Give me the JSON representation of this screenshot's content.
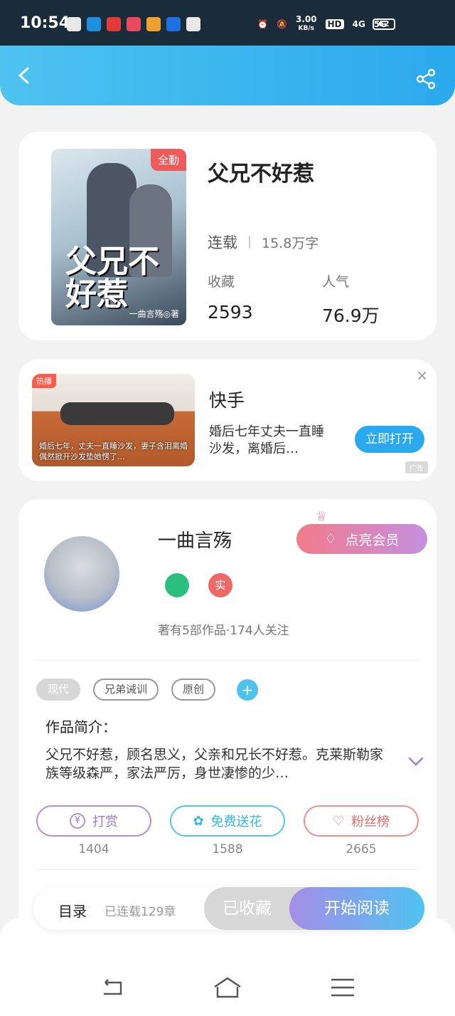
{
  "status_bar": {
    "time": "10:54",
    "net_speed": "3.00",
    "net_unit": "KB/s",
    "hd": "HD",
    "g4": "4G",
    "g5": "5G",
    "battery": "62"
  },
  "header": {
    "back_icon": "back-arrow-icon",
    "share_icon": "share-icon"
  },
  "book": {
    "badge": "全勤",
    "cover_title": "父兄不好惹",
    "cover_author": "一曲言殇◎著",
    "title": "父兄不好惹",
    "status": "连载",
    "words": "15.8万字",
    "collect_label": "收藏",
    "collect_value": "2593",
    "popularity_label": "人气",
    "popularity_value": "76.9万"
  },
  "ad": {
    "hot_label": "热播",
    "caption": "婚后七年，丈夫一直睡沙发，妻子含泪离婚 偶然掀开沙发垫她愣了...",
    "title": "快手",
    "desc": "婚后七年丈夫一直睡沙发，离婚后…",
    "button": "立即打开",
    "close": "×",
    "ad_tag": "广告"
  },
  "author": {
    "name": "一曲言殇",
    "vip_button": "点亮会员",
    "real_badge": "实",
    "info": "著有5部作品·174人关注",
    "tags": [
      "现代",
      "兄弟诫训",
      "原创"
    ],
    "add_tag": "+",
    "intro_label": "作品简介：",
    "intro_text": "父兄不好惹，顾名思义，父亲和兄长不好惹。克莱斯勒家族等级森严，家法严厉，身世凄惨的少…"
  },
  "actions": {
    "reward_label": "打赏",
    "reward_count": "1404",
    "flower_label": "免费送花",
    "flower_count": "1588",
    "fans_label": "粉丝榜",
    "fans_count": "2665"
  },
  "bottom_bar": {
    "catalog": "目录",
    "chapters": "已连载129章",
    "saved": "已收藏",
    "read": "开始阅读"
  }
}
